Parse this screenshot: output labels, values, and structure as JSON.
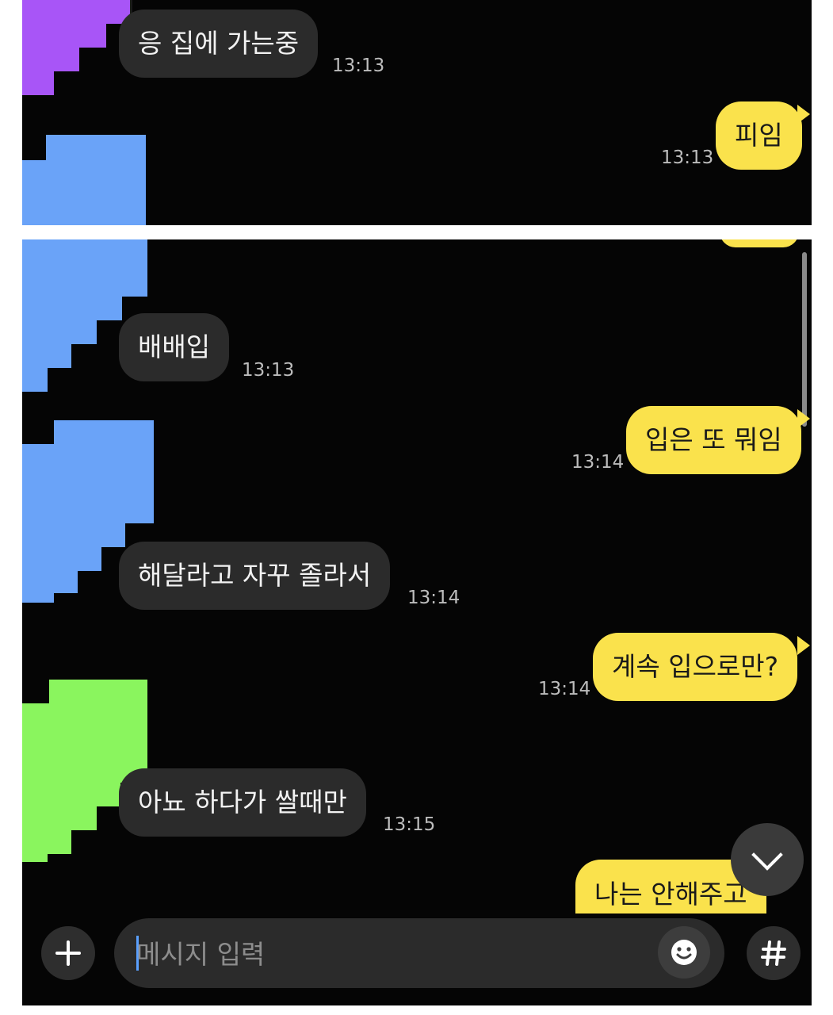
{
  "colors": {
    "background": "#050505",
    "incoming_bubble": "#2b2b2b",
    "outgoing_bubble": "#fae24c",
    "avatar_purple": "#a855f7",
    "avatar_blue": "#6aa3f8",
    "avatar_green": "#8af55e"
  },
  "messages": [
    {
      "text": "응 집에 가는중",
      "time": "13:13",
      "side": "incoming"
    },
    {
      "text": "피임",
      "time": "13:13",
      "side": "outgoing"
    },
    {
      "text": "배배입",
      "time": "13:13",
      "side": "incoming"
    },
    {
      "text": "입은 또 뭐임",
      "time": "13:14",
      "side": "outgoing"
    },
    {
      "text": "해달라고 자꾸 졸라서",
      "time": "13:14",
      "side": "incoming"
    },
    {
      "text": "계속 입으로만?",
      "time": "13:14",
      "side": "outgoing"
    },
    {
      "text": "아뇨 하다가 쌀때만",
      "time": "13:15",
      "side": "incoming"
    },
    {
      "text": "나는 안해주고",
      "time": "",
      "side": "outgoing"
    }
  ],
  "input": {
    "placeholder": "메시지 입력",
    "value": ""
  },
  "icons": {
    "add": "plus-icon",
    "emoji": "smile-icon",
    "hashtag": "hash-icon",
    "scroll_down": "chevron-down-icon"
  }
}
